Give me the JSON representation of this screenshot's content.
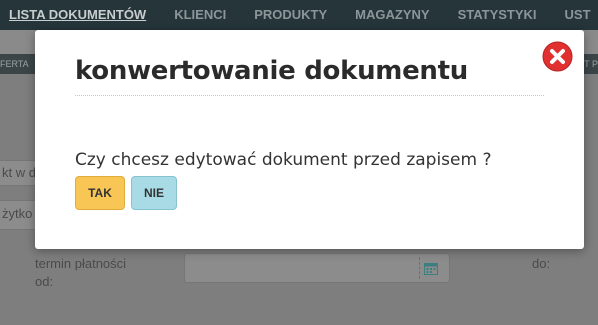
{
  "nav": {
    "items": [
      "LISTA DOKUMENTÓW",
      "KLIENCI",
      "PRODUKTY",
      "MAGAZYNY",
      "STATYSTYKI",
      "UST"
    ]
  },
  "subnav": {
    "left_text": "FERTA",
    "right_text": "T P"
  },
  "background": {
    "search_fragment": "kt w d",
    "user_fragment": "żytko",
    "due_date_label_line1": "termin płatności",
    "due_date_label_line2": "od:",
    "to_label": "do:"
  },
  "modal": {
    "title": "konwertowanie dokumentu",
    "question": "Czy chcesz edytować dokument przed zapisem ?",
    "yes_label": "TAK",
    "no_label": "NIE"
  },
  "colors": {
    "nav_bg": "#25353a",
    "yes_button": "#f8c655",
    "no_button": "#a9dbe6",
    "close_icon": "#e03030"
  }
}
